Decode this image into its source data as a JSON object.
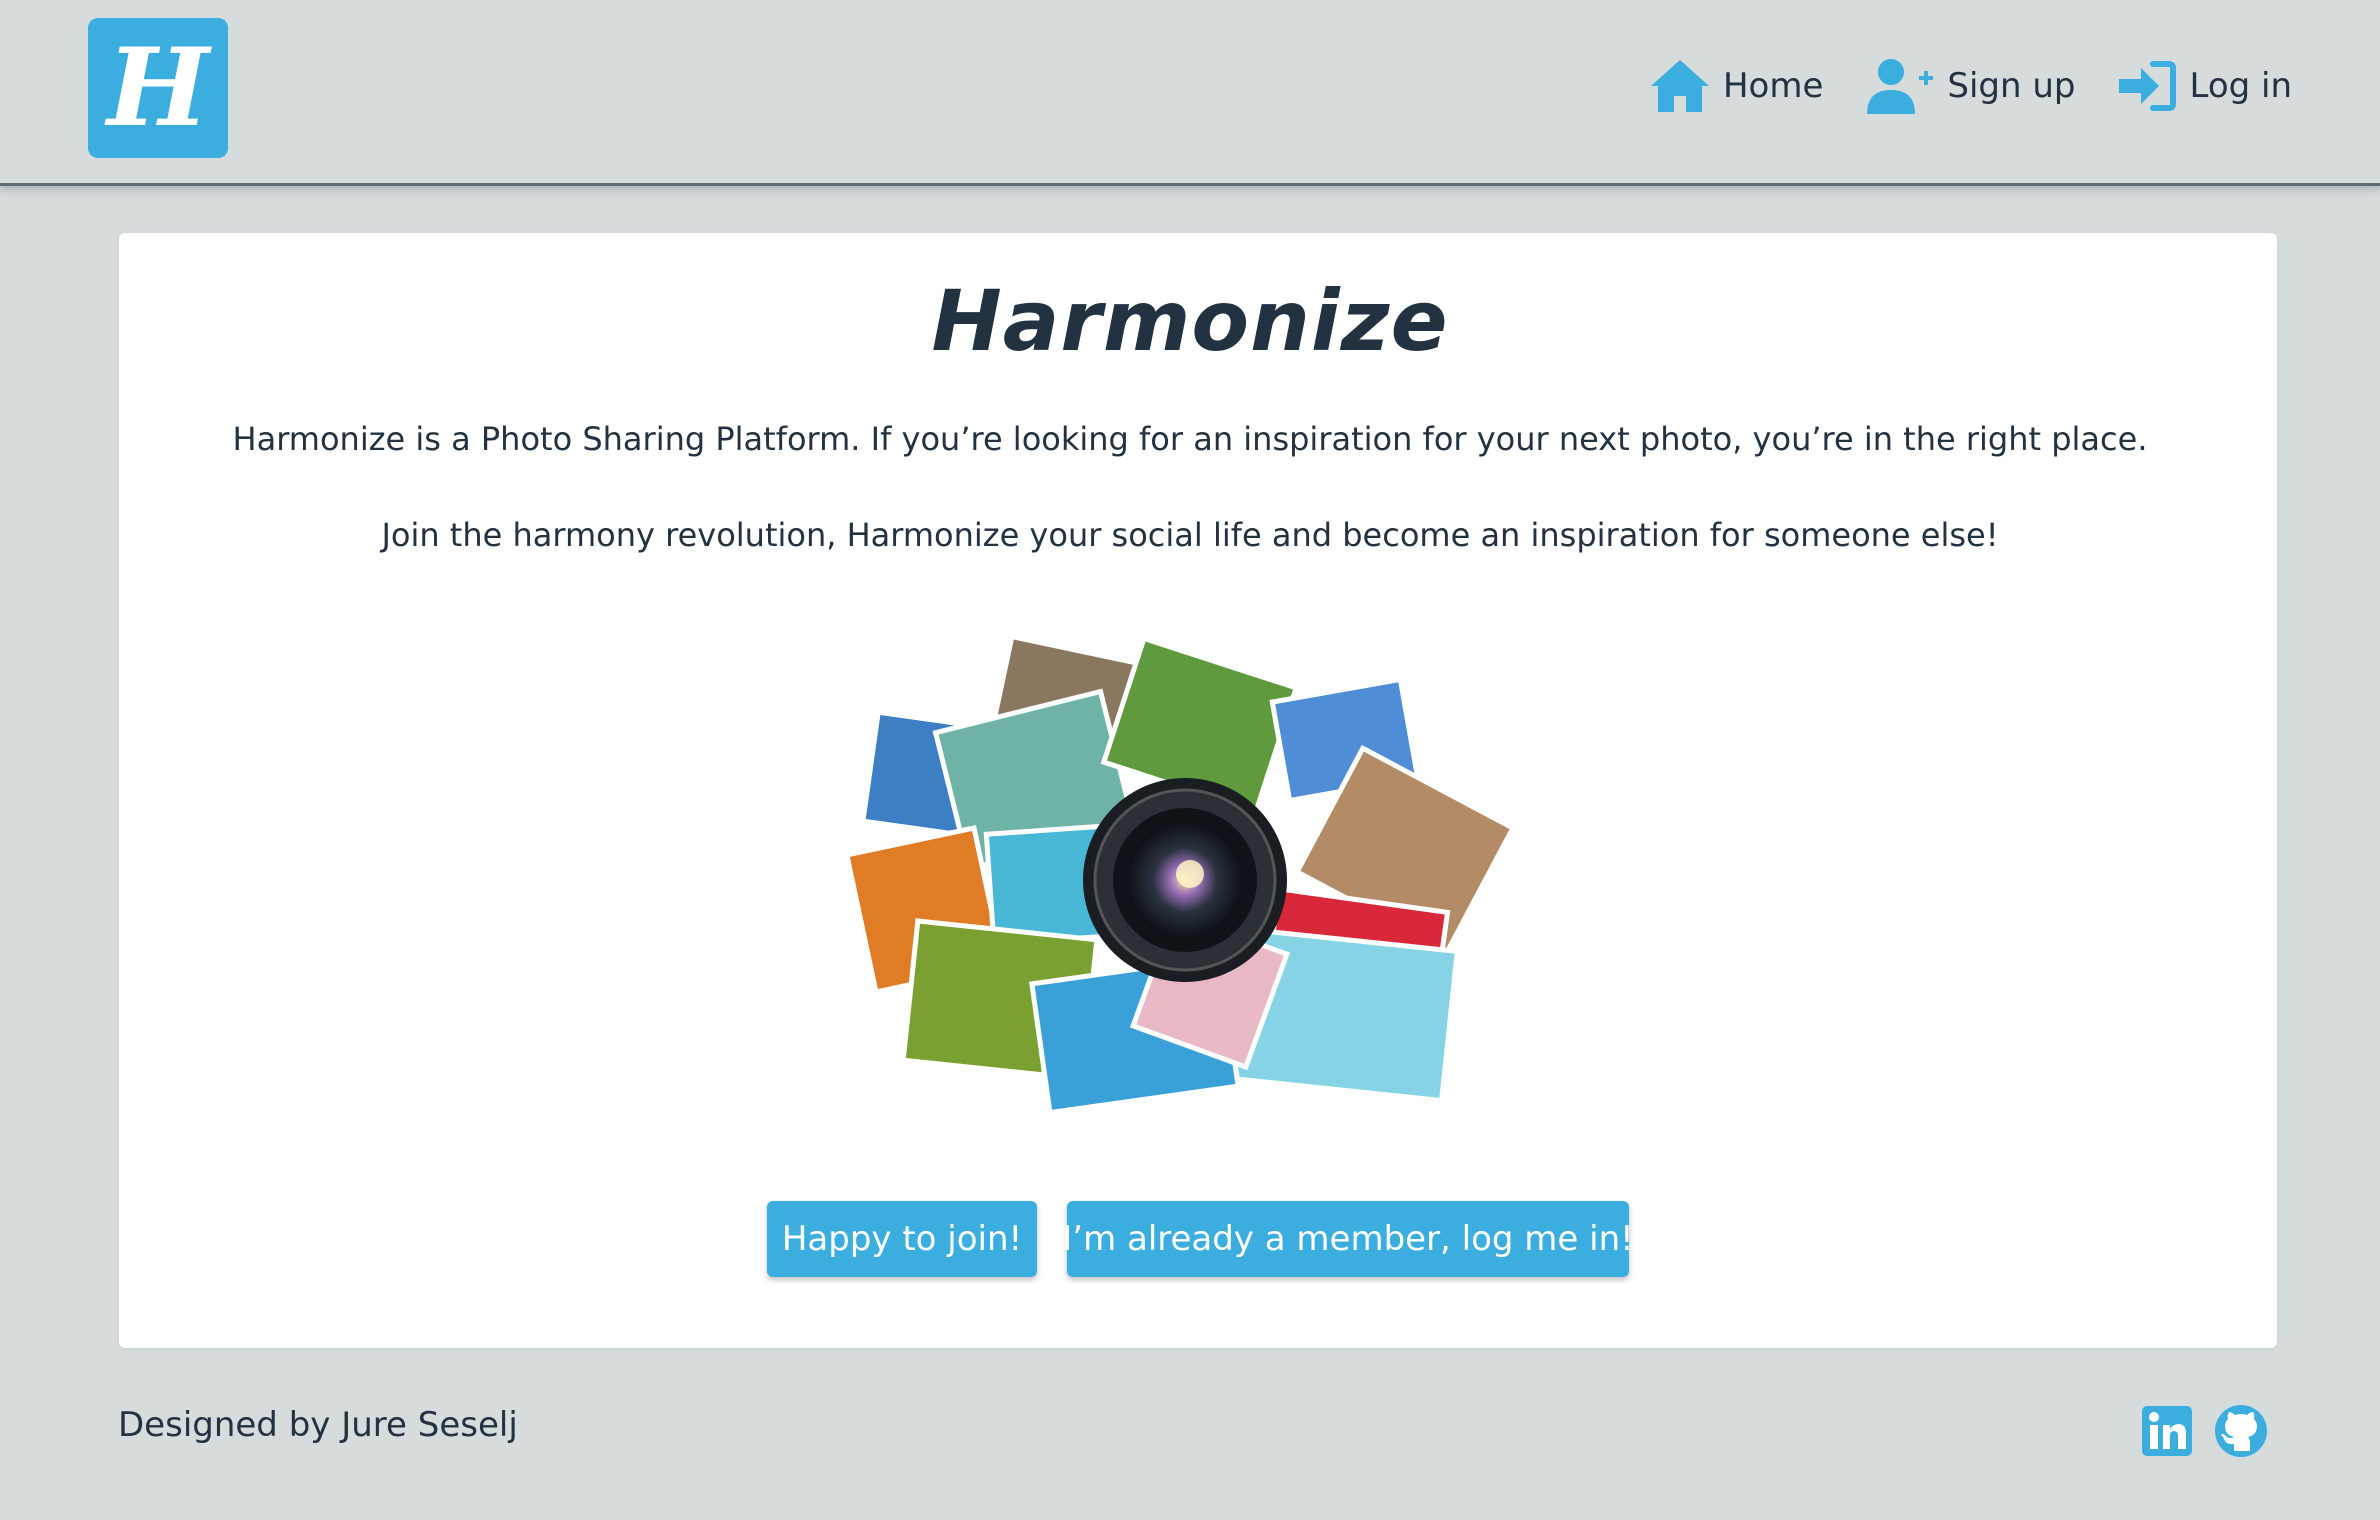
{
  "brand": {
    "logo_letter": "H"
  },
  "nav": {
    "home": "Home",
    "signup": "Sign up",
    "login": "Log in"
  },
  "main": {
    "title": "Harmonize",
    "paragraph1": "Harmonize is a Photo Sharing Platform. If you’re looking for an inspiration for your next photo, you’re in the right place.",
    "paragraph2": "Join the harmony revolution, Harmonize your social life and become an inspiration for someone else!",
    "join_button": "Happy to join!",
    "login_button": "I’m already a member, log me in!"
  },
  "footer": {
    "credit": "Designed by Jure Seselj",
    "icons": [
      "linkedin-icon",
      "github-icon"
    ]
  },
  "colors": {
    "accent": "#3badde",
    "background": "#d6dbdc",
    "text": "#233240",
    "card": "#ffffff"
  }
}
